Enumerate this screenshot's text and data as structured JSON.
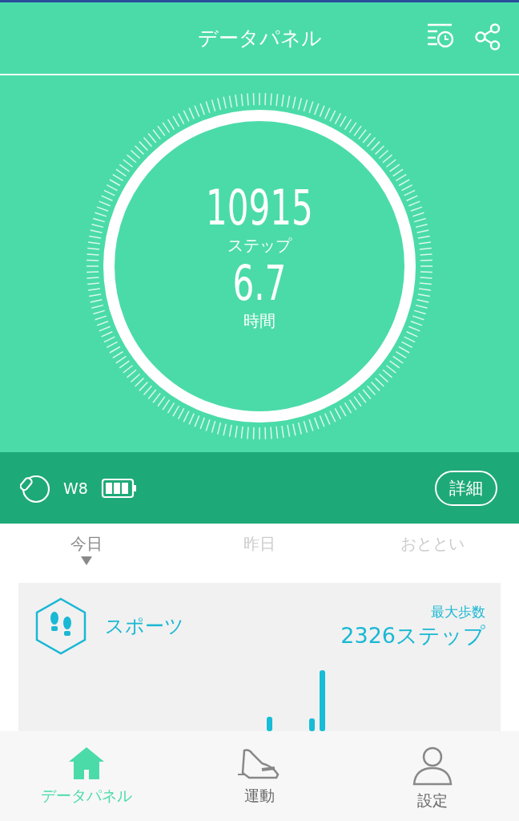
{
  "header": {
    "title": "データパネル"
  },
  "summary": {
    "steps": "10915",
    "steps_unit": "ステップ",
    "hours": "6.7",
    "hours_unit": "時間"
  },
  "device": {
    "name": "W8",
    "details_button": "詳細"
  },
  "day_tabs": [
    {
      "label": "今日",
      "selected": true
    },
    {
      "label": "昨日",
      "selected": false
    },
    {
      "label": "おととい",
      "selected": false
    }
  ],
  "sports_card": {
    "title": "スポーツ",
    "max_label": "最大歩数",
    "max_value": "2326ステップ"
  },
  "bottom_nav": [
    {
      "label": "データパネル",
      "kind": "home",
      "selected": true
    },
    {
      "label": "運動",
      "kind": "shoe",
      "selected": false
    },
    {
      "label": "設定",
      "kind": "person",
      "selected": false
    }
  ]
}
